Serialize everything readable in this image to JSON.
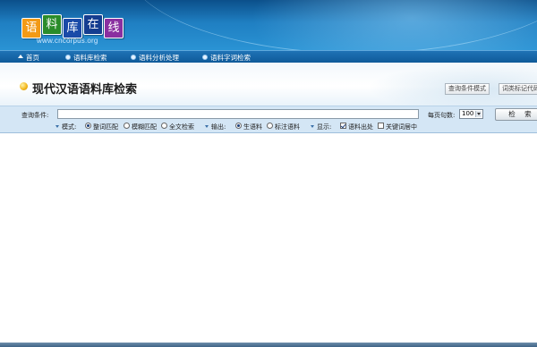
{
  "logo": {
    "chars": [
      "语",
      "料",
      "库",
      "在",
      "线"
    ],
    "url": "www.cncorpus.org"
  },
  "nav": [
    {
      "label": "首页",
      "icon": "home-icon"
    },
    {
      "label": "语料库检索",
      "icon": "bullet-icon"
    },
    {
      "label": "语料分析处理",
      "icon": "bullet-icon"
    },
    {
      "label": "语料字词检索",
      "icon": "bullet-icon"
    }
  ],
  "page": {
    "title": "现代汉语语料库检索"
  },
  "tabs": {
    "query_mode": "查询条件模式",
    "pos_tag": "词类标记代码"
  },
  "search": {
    "query_label": "查询条件:",
    "query_value": "",
    "per_page_label": "每页句数:",
    "per_page_value": "100",
    "search_button": "检 索"
  },
  "options": {
    "mode_label": "模式:",
    "mode_options": [
      "整词匹配",
      "模糊匹配",
      "全文检索"
    ],
    "mode_selected": 0,
    "output_label": "输出:",
    "output_options": [
      "生语料",
      "标注语料"
    ],
    "output_selected": 0,
    "display_label": "显示:",
    "display_options": [
      {
        "label": "语料出处",
        "checked": true
      },
      {
        "label": "关键词居中",
        "checked": false
      }
    ]
  },
  "colors": {
    "banner": "#1f7fc2",
    "navbar": "#0f5a99",
    "panel": "#d4e6f5"
  }
}
